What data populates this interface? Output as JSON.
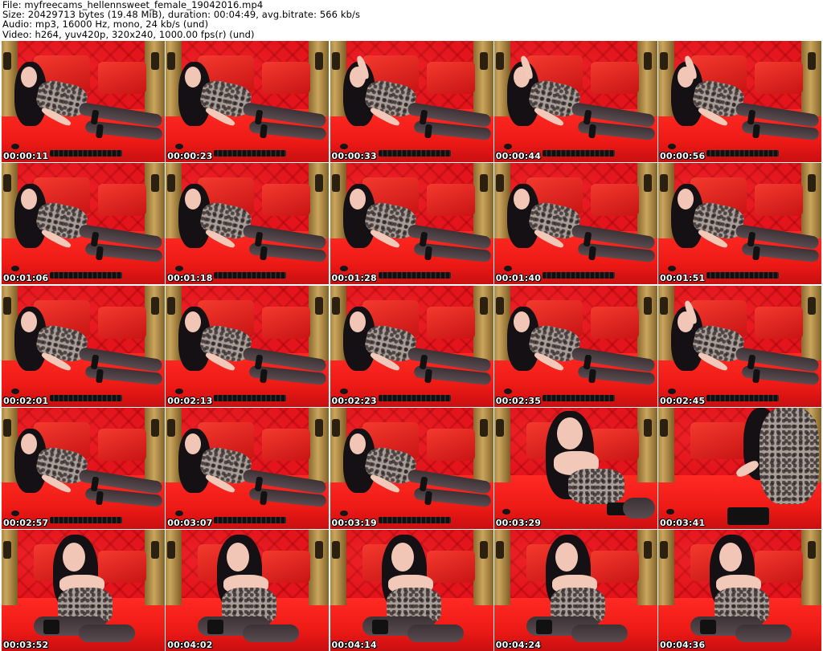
{
  "header": {
    "file_line": "File: myfreecams_hellennsweet_female_19042016.mp4",
    "size_line": "Size: 20429713 bytes (19.48 MiB), duration: 00:04:49, avg.bitrate: 566 kb/s",
    "audio_line": "Audio: mp3, 16000 Hz, mono, 24 kb/s (und)",
    "video_line": "Video: h264, yuv420p, 320x240, 1000.00 fps(r) (und)"
  },
  "colors": {
    "backdrop_red": "#e3141c",
    "bed_red": "#ee1a16",
    "gold_trim": "#caa55c",
    "timestamp_text": "#ffffff"
  },
  "thumbnails": [
    {
      "time": "00:00:11",
      "pose": "lying"
    },
    {
      "time": "00:00:23",
      "pose": "lying"
    },
    {
      "time": "00:00:33",
      "pose": "lying-arm-up"
    },
    {
      "time": "00:00:44",
      "pose": "lying-arm-up"
    },
    {
      "time": "00:00:56",
      "pose": "lying-arm-up"
    },
    {
      "time": "00:01:06",
      "pose": "lying"
    },
    {
      "time": "00:01:18",
      "pose": "lying"
    },
    {
      "time": "00:01:28",
      "pose": "lying"
    },
    {
      "time": "00:01:40",
      "pose": "lying"
    },
    {
      "time": "00:01:51",
      "pose": "lying"
    },
    {
      "time": "00:02:01",
      "pose": "lying"
    },
    {
      "time": "00:02:13",
      "pose": "lying"
    },
    {
      "time": "00:02:23",
      "pose": "lying"
    },
    {
      "time": "00:02:35",
      "pose": "lying"
    },
    {
      "time": "00:02:45",
      "pose": "lying-arm-up"
    },
    {
      "time": "00:02:57",
      "pose": "lying"
    },
    {
      "time": "00:03:07",
      "pose": "lying"
    },
    {
      "time": "00:03:19",
      "pose": "lying"
    },
    {
      "time": "00:03:29",
      "pose": "kneeling-close"
    },
    {
      "time": "00:03:41",
      "pose": "torso-close"
    },
    {
      "time": "00:03:52",
      "pose": "sitting"
    },
    {
      "time": "00:04:02",
      "pose": "sitting"
    },
    {
      "time": "00:04:14",
      "pose": "sitting"
    },
    {
      "time": "00:04:24",
      "pose": "sitting"
    },
    {
      "time": "00:04:36",
      "pose": "sitting"
    }
  ]
}
